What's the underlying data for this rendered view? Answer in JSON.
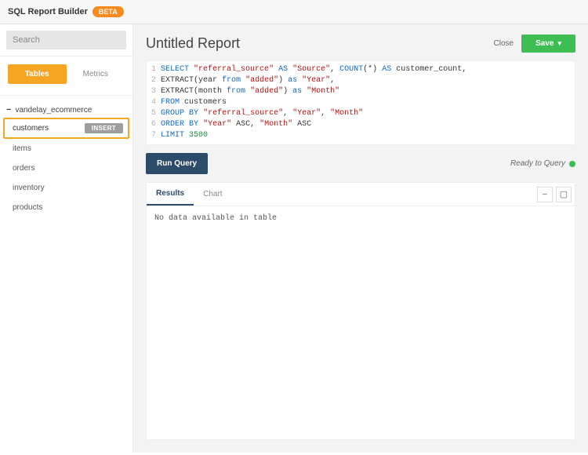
{
  "header": {
    "title": "SQL Report Builder",
    "badge": "BETA"
  },
  "sidebar": {
    "search_placeholder": "Search",
    "tabs": {
      "tables": "Tables",
      "metrics": "Metrics"
    },
    "group": "vandelay_ecommerce",
    "insert_label": "INSERT",
    "items": [
      {
        "label": "customers"
      },
      {
        "label": "items"
      },
      {
        "label": "orders"
      },
      {
        "label": "inventory"
      },
      {
        "label": "products"
      }
    ]
  },
  "toolbar": {
    "report_title": "Untitled Report",
    "close": "Close",
    "save": "Save"
  },
  "sql": {
    "line1": {
      "a": "SELECT",
      "b": "\"referral_source\"",
      "c": "AS",
      "d": "\"Source\"",
      "e": "COUNT",
      "f": "AS",
      "g": "customer_count,"
    },
    "line2": {
      "a": "EXTRACT(year",
      "b": "from",
      "c": "\"added\"",
      "d": "as",
      "e": "\"Year\""
    },
    "line3": {
      "a": "EXTRACT(month",
      "b": "from",
      "c": "\"added\"",
      "d": "as",
      "e": "\"Month\""
    },
    "line4": {
      "a": "FROM",
      "b": "customers"
    },
    "line5": {
      "a": "GROUP",
      "b": "BY",
      "c": "\"referral_source\"",
      "d": "\"Year\"",
      "e": "\"Month\""
    },
    "line6": {
      "a": "ORDER",
      "b": "BY",
      "c": "\"Year\"",
      "d": "ASC,",
      "e": "\"Month\"",
      "f": "ASC"
    },
    "line7": {
      "a": "LIMIT",
      "b": "3500"
    }
  },
  "run": {
    "button": "Run Query",
    "status": "Ready to Query"
  },
  "results": {
    "tabs": {
      "results": "Results",
      "chart": "Chart"
    },
    "empty": "No data available in table"
  }
}
